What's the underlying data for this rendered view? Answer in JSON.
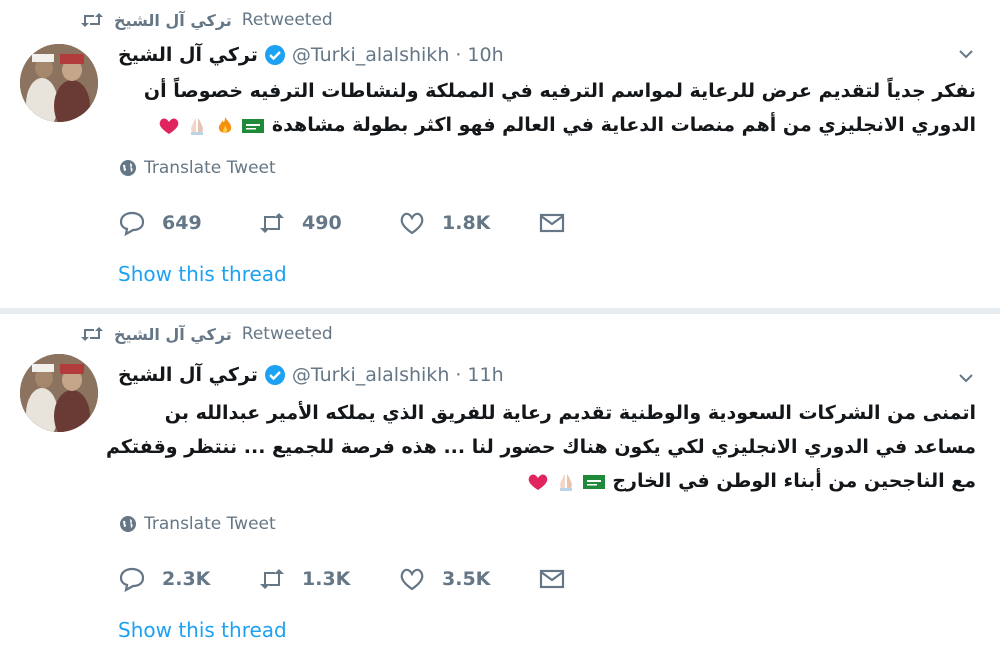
{
  "tweets": [
    {
      "retweeted_by": "تركي آل الشيخ",
      "retweeted_label": "Retweeted",
      "author_name": "تركي آل الشيخ",
      "handle": "@Turki_alalshikh",
      "separator": "·",
      "time": "10h",
      "text": "نفكر جدياً لتقديم عرض للرعاية لمواسم الترفيه في المملكة ولنشاطات الترفيه خصوصاً أن الدوري الانجليزي من أهم منصات الدعاية في العالم فهو اكثر بطولة مشاهدة",
      "emojis": [
        "saudi-flag-icon",
        "fire-icon",
        "praying-hands-icon",
        "red-heart-icon"
      ],
      "translate_label": "Translate Tweet",
      "replies": "649",
      "retweets": "490",
      "likes": "1.8K",
      "show_thread": "Show this thread"
    },
    {
      "retweeted_by": "تركي آل الشيخ",
      "retweeted_label": "Retweeted",
      "author_name": "تركي آل الشيخ",
      "handle": "@Turki_alalshikh",
      "separator": "·",
      "time": "11h",
      "text": "اتمنى من الشركات السعودية والوطنية تقديم رعاية للفريق الذي يملكه الأمير عبدالله بن مساعد في الدوري الانجليزي لكي يكون هناك حضور لنا ... هذه فرصة للجميع ... ننتظر وقفتكم مع الناجحين من أبناء الوطن في الخارج",
      "emojis": [
        "saudi-flag-icon",
        "praying-hands-icon",
        "red-heart-icon"
      ],
      "translate_label": "Translate Tweet",
      "replies": "2.3K",
      "retweets": "1.3K",
      "likes": "3.5K",
      "show_thread": "Show this thread"
    }
  ],
  "colors": {
    "accent": "#1da1f2",
    "muted": "#657786",
    "divider": "#e6ecf0",
    "heart": "#e0245e",
    "flag_green": "#1f8a3a"
  }
}
